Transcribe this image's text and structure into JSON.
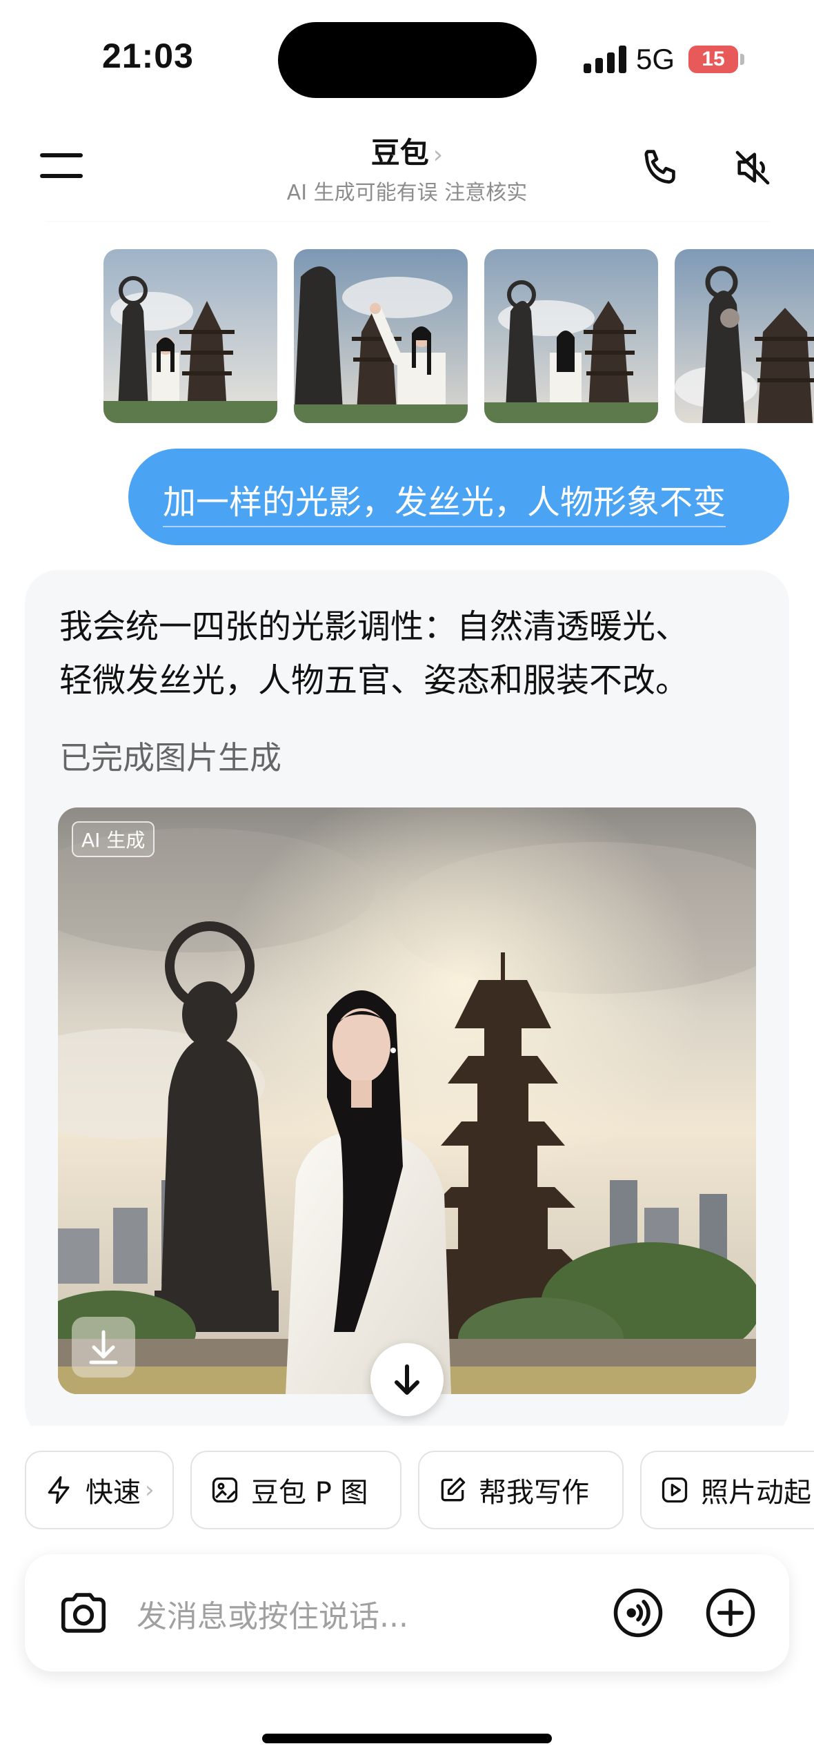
{
  "status_bar": {
    "time": "21:03",
    "network": "5G",
    "battery": "15"
  },
  "header": {
    "title": "豆包",
    "title_chevron": "›",
    "subtitle": "AI 生成可能有误 注意核实"
  },
  "thumbnails": [
    {
      "name": "thumbnail-1"
    },
    {
      "name": "thumbnail-2"
    },
    {
      "name": "thumbnail-3"
    },
    {
      "name": "thumbnail-4"
    }
  ],
  "user_message": {
    "text": "加一样的光影，发丝光，人物形象不变"
  },
  "ai_message": {
    "lines": [
      "我会统一四张的光影调性：自然清透暖光、",
      "轻微发丝光，人物五官、姿态和服装不改。"
    ],
    "status": "已完成图片生成",
    "image_tag": "AI 生成"
  },
  "quick_actions": [
    {
      "label": "快速",
      "icon": "lightning-icon",
      "chevron": "›"
    },
    {
      "label": "豆包 P 图",
      "icon": "photo-edit-icon"
    },
    {
      "label": "帮我写作",
      "icon": "edit-note-icon"
    },
    {
      "label": "照片动起",
      "icon": "play-icon"
    }
  ],
  "input": {
    "placeholder": "发消息或按住说话..."
  },
  "colors": {
    "user_bubble": "#4aa3f3",
    "card_background": "#f6f7f8",
    "battery_low": "#e85a5a"
  }
}
